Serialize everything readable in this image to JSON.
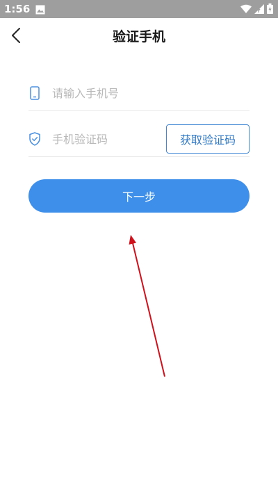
{
  "status_bar": {
    "time": "1:56"
  },
  "header": {
    "title": "验证手机"
  },
  "form": {
    "phone_placeholder": "请输入手机号",
    "code_placeholder": "手机验证码",
    "get_code_label": "获取验证码",
    "next_label": "下一步"
  },
  "colors": {
    "primary": "#3d8fea",
    "outline_button": "#3f86d4",
    "status_bar": "#9e9e9e",
    "annotation_arrow": "#d0101a"
  },
  "icons": {
    "back": "chevron-left-icon",
    "phone": "phone-icon",
    "code": "shield-check-icon",
    "gallery": "image-icon",
    "wifi": "wifi-icon",
    "signal": "signal-icon",
    "battery": "battery-icon"
  }
}
